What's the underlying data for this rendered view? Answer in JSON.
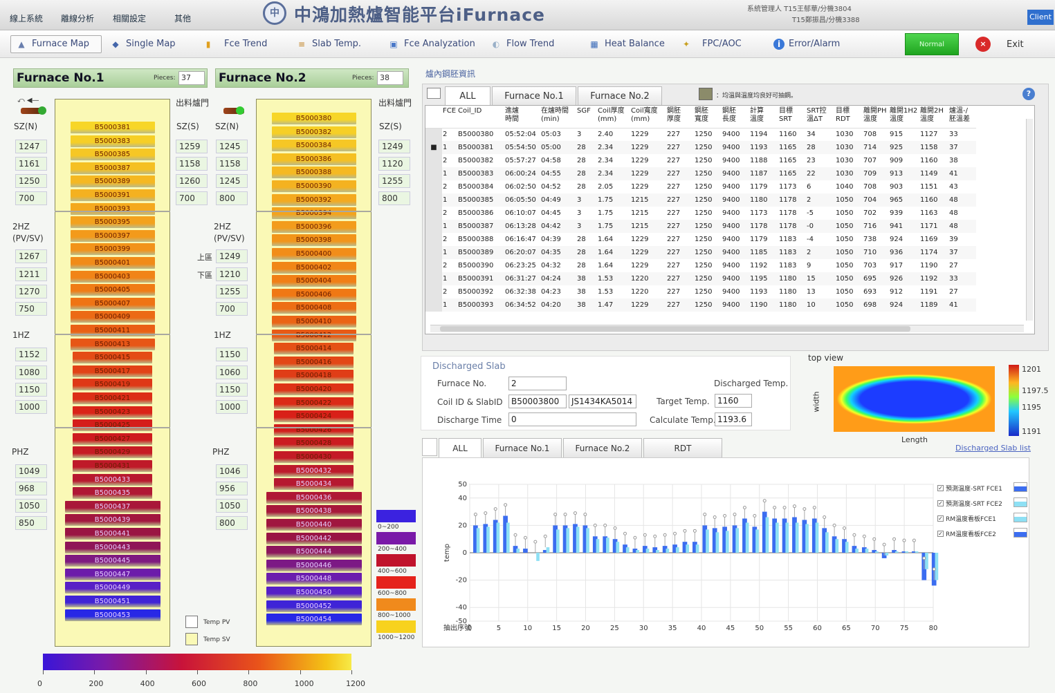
{
  "topmenu": [
    "線上系統",
    "離線分析",
    "相關設定",
    "其他"
  ],
  "title": "中鴻加熱爐智能平台iFurnace",
  "logo": "中",
  "user": {
    "line1": "系統管理人 T15王郁華/分機3804",
    "line2": "T15鄭振昌/分機3388"
  },
  "client": "Client",
  "toolbar": [
    {
      "label": "Furnace Map",
      "icon": "furnace-map-icon",
      "glyph": "▲",
      "color": "#6a7fae"
    },
    {
      "label": "Single Map",
      "icon": "single-map-icon",
      "glyph": "◆",
      "color": "#4466aa"
    },
    {
      "label": "Fce Trend",
      "icon": "trend-bars-icon",
      "glyph": "▮",
      "color": "#e0a020"
    },
    {
      "label": "Slab Temp.",
      "icon": "slab-temp-icon",
      "glyph": "≡",
      "color": "#c08020"
    },
    {
      "label": "Fce Analyzation",
      "icon": "analyzation-icon",
      "glyph": "▣",
      "color": "#4a78c8"
    },
    {
      "label": "Flow Trend",
      "icon": "flow-trend-icon",
      "glyph": "◐",
      "color": "#9ab0c8"
    },
    {
      "label": "Heat Balance",
      "icon": "heat-balance-icon",
      "glyph": "▦",
      "color": "#3a6ab8"
    },
    {
      "label": "FPC/AOC",
      "icon": "fpc-aoc-icon",
      "glyph": "✦",
      "color": "#c8a020"
    },
    {
      "label": "Error/Alarm",
      "icon": "info-icon",
      "glyph": "i",
      "color": "#3a78d8"
    }
  ],
  "normal": "Normal",
  "exit": "Exit",
  "f1": {
    "title": "Furnace No.1",
    "pieces_label": "Pieces:",
    "pieces": "37",
    "slabs": [
      "B5000381",
      "B5000383",
      "B5000385",
      "B5000387",
      "B5000389",
      "B5000391",
      "B5000393",
      "B5000395",
      "B5000397",
      "B5000399",
      "B5000401",
      "B5000403",
      "B5000405",
      "B5000407",
      "B5000409",
      "B5000411",
      "B5000413",
      "B5000415",
      "B5000417",
      "B5000419",
      "B5000421",
      "B5000423",
      "B5000425",
      "B5000427",
      "B5000429",
      "B5000431",
      "B5000433",
      "B5000435",
      "B5000437",
      "B5000439",
      "B5000441",
      "B5000443",
      "B5000445",
      "B5000447",
      "B5000449",
      "B5000451",
      "B5000453"
    ],
    "sz_n": [
      "1247",
      "1161",
      "1250",
      "700"
    ],
    "sz_s": [
      "1259",
      "1158",
      "1260",
      "700"
    ],
    "z2": [
      "1267",
      "1211",
      "1270",
      "750"
    ],
    "z1": [
      "1152",
      "1080",
      "1150",
      "1000"
    ],
    "ph": [
      "1049",
      "968",
      "1050",
      "850"
    ]
  },
  "f2": {
    "title": "Furnace No.2",
    "pieces_label": "Pieces:",
    "pieces": "38",
    "slabs": [
      "B5000380",
      "B5000382",
      "B5000384",
      "B5000386",
      "B5000388",
      "B5000390",
      "B5000392",
      "B5000394",
      "B5000396",
      "B5000398",
      "B5000400",
      "B5000402",
      "B5000404",
      "B5000406",
      "B5000408",
      "B5000410",
      "B5000412",
      "B5000414",
      "B5000416",
      "B5000418",
      "B5000420",
      "B5000422",
      "B5000424",
      "B5000426",
      "B5000428",
      "B5000430",
      "B5000432",
      "B5000434",
      "B5000436",
      "B5000438",
      "B5000440",
      "B5000442",
      "B5000444",
      "B5000446",
      "B5000448",
      "B5000450",
      "B5000452",
      "B5000454"
    ],
    "sz_n": [
      "1245",
      "1158",
      "1245",
      "800"
    ],
    "sz_s": [
      "1249",
      "1120",
      "1255",
      "800"
    ],
    "z2": [
      "1249",
      "1210",
      "1255",
      "700"
    ],
    "z1": [
      "1150",
      "1060",
      "1150",
      "1000"
    ],
    "ph": [
      "1046",
      "956",
      "1050",
      "800"
    ]
  },
  "labels": {
    "exit_door": "出料爐門",
    "szn": "SZ(N)",
    "szs": "SZ(S)",
    "z2": "2HZ\n(PV/SV)",
    "z1": "1HZ",
    "ph": "PHZ",
    "upper": "上區",
    "lower": "下區",
    "tpv": "Temp PV",
    "tsv": "Temp SV"
  },
  "temp_legend": [
    "0~200",
    "200~400",
    "400~600",
    "600~800",
    "800~1000",
    "1000~1200"
  ],
  "temp_legend_colors": [
    "#3b22e0",
    "#7a1aa8",
    "#c0132c",
    "#e5231c",
    "#f08a1c",
    "#f7d21e"
  ],
  "cbar_ticks": [
    "0",
    "200",
    "400",
    "600",
    "800",
    "1000",
    "1200"
  ],
  "table": {
    "section": "爐內鋼胚資訊",
    "tabs": [
      "ALL",
      "Furnace No.1",
      "Furnace No.2"
    ],
    "legend_note": "：均溫與溫度均良好可抽鋼。",
    "headers": [
      "",
      "FCE",
      "Coil_ID",
      "進爐\n時間",
      "在爐時間\n(min)",
      "SGF",
      "Coil厚度\n(mm)",
      "Coil寬度\n(mm)",
      "鋼胚\n厚度",
      "鋼胚\n寬度",
      "鋼胚\n長度",
      "計算\n溫度",
      "目標\nSRT",
      "SRT控\n溫ΔT",
      "目標\nRDT",
      "離開PH\n溫度",
      "離開1H2\n溫度",
      "離開2H\n溫度",
      "爐溫-/\n胚溫差"
    ],
    "rows": [
      [
        "",
        "2",
        "B5000380",
        "05:52:04",
        "05:03",
        "3",
        "2.40",
        "1229",
        "227",
        "1250",
        "9400",
        "1194",
        "1160",
        "34",
        "1030",
        "708",
        "915",
        "1127",
        "33"
      ],
      [
        "■",
        "1",
        "B5000381",
        "05:54:50",
        "05:00",
        "28",
        "2.34",
        "1229",
        "227",
        "1250",
        "9400",
        "1193",
        "1165",
        "28",
        "1030",
        "714",
        "925",
        "1158",
        "37"
      ],
      [
        "",
        "2",
        "B5000382",
        "05:57:27",
        "04:58",
        "28",
        "2.34",
        "1229",
        "227",
        "1250",
        "9400",
        "1188",
        "1165",
        "23",
        "1030",
        "707",
        "909",
        "1160",
        "38"
      ],
      [
        "",
        "1",
        "B5000383",
        "06:00:24",
        "04:55",
        "28",
        "2.34",
        "1229",
        "227",
        "1250",
        "9400",
        "1187",
        "1165",
        "22",
        "1030",
        "709",
        "913",
        "1149",
        "41"
      ],
      [
        "",
        "2",
        "B5000384",
        "06:02:50",
        "04:52",
        "28",
        "2.05",
        "1229",
        "227",
        "1250",
        "9400",
        "1179",
        "1173",
        "6",
        "1040",
        "708",
        "903",
        "1151",
        "43"
      ],
      [
        "",
        "1",
        "B5000385",
        "06:05:50",
        "04:49",
        "3",
        "1.75",
        "1215",
        "227",
        "1250",
        "9400",
        "1180",
        "1178",
        "2",
        "1050",
        "704",
        "965",
        "1160",
        "48"
      ],
      [
        "",
        "2",
        "B5000386",
        "06:10:07",
        "04:45",
        "3",
        "1.75",
        "1215",
        "227",
        "1250",
        "9400",
        "1173",
        "1178",
        "-5",
        "1050",
        "702",
        "939",
        "1163",
        "48"
      ],
      [
        "",
        "1",
        "B5000387",
        "06:13:28",
        "04:42",
        "3",
        "1.75",
        "1215",
        "227",
        "1250",
        "9400",
        "1178",
        "1178",
        "-0",
        "1050",
        "716",
        "941",
        "1171",
        "48"
      ],
      [
        "",
        "2",
        "B5000388",
        "06:16:47",
        "04:39",
        "28",
        "1.64",
        "1229",
        "227",
        "1250",
        "9400",
        "1179",
        "1183",
        "-4",
        "1050",
        "738",
        "924",
        "1169",
        "39"
      ],
      [
        "",
        "1",
        "B5000389",
        "06:20:07",
        "04:35",
        "28",
        "1.64",
        "1229",
        "227",
        "1250",
        "9400",
        "1185",
        "1183",
        "2",
        "1050",
        "710",
        "936",
        "1174",
        "37"
      ],
      [
        "",
        "2",
        "B5000390",
        "06:23:25",
        "04:32",
        "28",
        "1.64",
        "1229",
        "227",
        "1250",
        "9400",
        "1192",
        "1183",
        "9",
        "1050",
        "703",
        "917",
        "1190",
        "27"
      ],
      [
        "",
        "1",
        "B5000391",
        "06:31:27",
        "04:24",
        "38",
        "1.53",
        "1220",
        "227",
        "1250",
        "9400",
        "1195",
        "1180",
        "15",
        "1050",
        "695",
        "926",
        "1192",
        "33"
      ],
      [
        "",
        "2",
        "B5000392",
        "06:32:38",
        "04:23",
        "38",
        "1.53",
        "1220",
        "227",
        "1250",
        "9400",
        "1193",
        "1180",
        "13",
        "1050",
        "693",
        "912",
        "1191",
        "27"
      ],
      [
        "",
        "1",
        "B5000393",
        "06:34:52",
        "04:20",
        "38",
        "1.47",
        "1229",
        "227",
        "1250",
        "9400",
        "1190",
        "1180",
        "10",
        "1050",
        "698",
        "924",
        "1189",
        "41"
      ]
    ]
  },
  "discharged": {
    "title": "Discharged Slab",
    "furnace_no_label": "Furnace No.",
    "furnace_no": "2",
    "coil_label": "Coil ID & SlabID",
    "coil_id": "B50003800",
    "slab_id": "JS1434KA5014",
    "time_label": "Discharge Time",
    "time": "0",
    "dtemp_label": "Discharged Temp.",
    "target_label": "Target Temp.",
    "target": "1160",
    "calc_label": "Calculate Temp.",
    "calc": "1193.6"
  },
  "heatmap": {
    "view": "top view",
    "ylabel": "width",
    "xlabel": "Length",
    "scale": [
      "1201",
      "1197.5",
      "1195",
      "1191"
    ]
  },
  "bottom_tabs": [
    "ALL",
    "Furnace No.1",
    "Furnace No.2",
    "RDT"
  ],
  "discharged_list": "Discharged Slab list",
  "chart_data": {
    "type": "bar",
    "ylabel": "temp",
    "xlabel": "抽出序號",
    "ylim": [
      -50,
      50
    ],
    "xlim": [
      0,
      80
    ],
    "yticks": [
      "50",
      "40",
      "20",
      "0",
      "-20",
      "-40",
      "-50"
    ],
    "xticks": [
      "0",
      "5",
      "10",
      "15",
      "20",
      "25",
      "30",
      "35",
      "40",
      "45",
      "50",
      "55",
      "60",
      "65",
      "70",
      "75",
      "80"
    ],
    "series": [
      {
        "name": "預測溫度-SRT FCE1",
        "values": [
          20,
          21,
          24,
          27,
          5,
          3,
          0,
          2,
          20,
          20,
          21,
          20,
          12,
          12,
          10,
          6,
          3,
          5,
          4,
          5,
          6,
          8,
          8,
          20,
          18,
          19,
          20,
          25,
          19,
          30,
          25,
          25,
          26,
          24,
          25,
          18,
          12,
          10,
          5,
          4,
          2,
          -4,
          2,
          1,
          1,
          -20,
          -24
        ]
      },
      {
        "name": "預測溫度-SRT FCE2",
        "values": [
          18,
          19,
          22,
          22,
          3,
          0,
          -6,
          4,
          17,
          18,
          19,
          18,
          10,
          11,
          8,
          4,
          2,
          3,
          2,
          3,
          4,
          6,
          6,
          17,
          15,
          16,
          18,
          22,
          17,
          26,
          22,
          22,
          22,
          21,
          22,
          15,
          10,
          8,
          3,
          3,
          1,
          -2,
          1,
          1,
          1,
          -12,
          -20
        ]
      },
      {
        "name": "RM溫度看板FCE1",
        "values": []
      },
      {
        "name": "RM溫度看板FCE2",
        "values": []
      }
    ]
  }
}
